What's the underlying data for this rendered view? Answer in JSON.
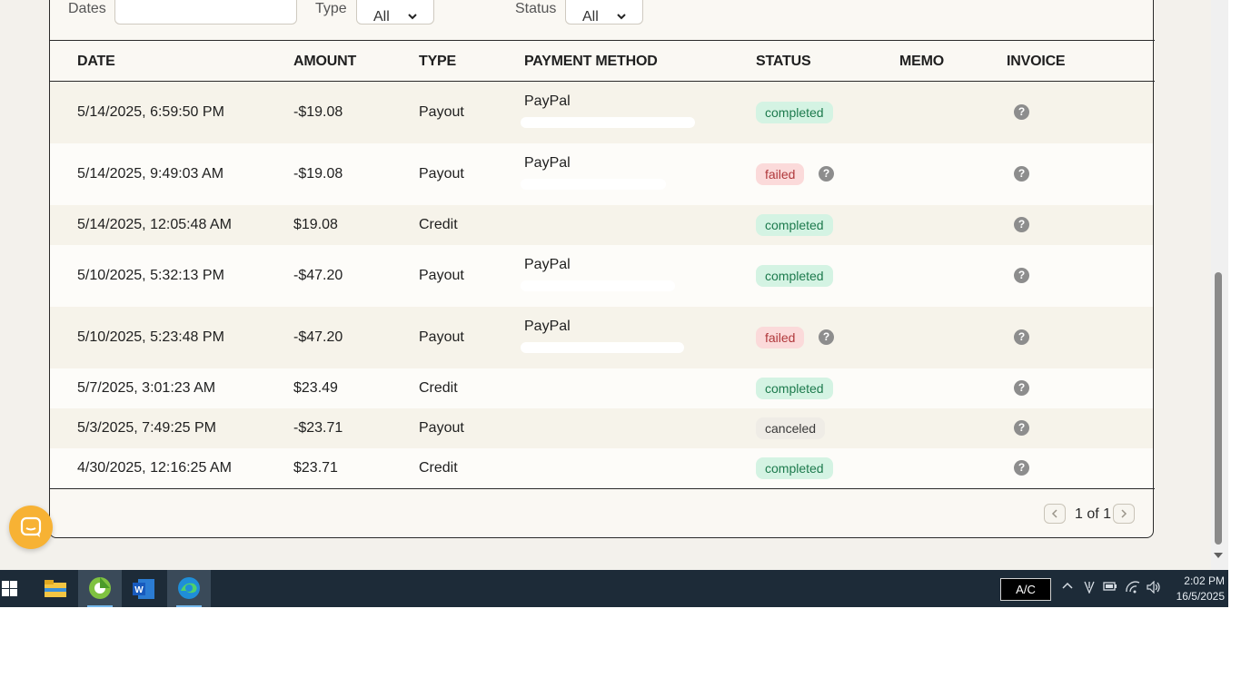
{
  "filters": {
    "dates_label": "Dates",
    "dates_value": "",
    "type_label": "Type",
    "type_value": "All",
    "status_label": "Status",
    "status_value": "All"
  },
  "table": {
    "headers": [
      "DATE",
      "AMOUNT",
      "TYPE",
      "PAYMENT METHOD",
      "STATUS",
      "MEMO",
      "INVOICE"
    ],
    "rows": [
      {
        "date": "5/14/2025, 6:59:50 PM",
        "amount": "-$19.08",
        "type": "Payout",
        "method": "PayPal",
        "status": "completed",
        "memo": ""
      },
      {
        "date": "5/14/2025, 9:49:03 AM",
        "amount": "-$19.08",
        "type": "Payout",
        "method": "PayPal",
        "status": "failed",
        "memo": ""
      },
      {
        "date": "5/14/2025, 12:05:48 AM",
        "amount": "$19.08",
        "type": "Credit",
        "method": "",
        "status": "completed",
        "memo": ""
      },
      {
        "date": "5/10/2025, 5:32:13 PM",
        "amount": "-$47.20",
        "type": "Payout",
        "method": "PayPal",
        "status": "completed",
        "memo": ""
      },
      {
        "date": "5/10/2025, 5:23:48 PM",
        "amount": "-$47.20",
        "type": "Payout",
        "method": "PayPal",
        "status": "failed",
        "memo": ""
      },
      {
        "date": "5/7/2025, 3:01:23 AM",
        "amount": "$23.49",
        "type": "Credit",
        "method": "",
        "status": "completed",
        "memo": ""
      },
      {
        "date": "5/3/2025, 7:49:25 PM",
        "amount": "-$23.71",
        "type": "Payout",
        "method": "",
        "status": "canceled",
        "memo": ""
      },
      {
        "date": "4/30/2025, 12:16:25 AM",
        "amount": "$23.71",
        "type": "Credit",
        "method": "",
        "status": "completed",
        "memo": ""
      }
    ]
  },
  "pagination": {
    "text": "1 of 1",
    "prev_icon": "chevron-left-icon",
    "next_icon": "chevron-right-icon"
  },
  "icons": {
    "help": "?",
    "chat": "chat-bubble-icon"
  },
  "colors": {
    "completed_bg": "#d4f3e3",
    "completed_text": "#1d7a4d",
    "failed_bg": "#fbdada",
    "failed_text": "#b0383b",
    "canceled_bg": "#efece6",
    "chat_accent": "#f7b234",
    "taskbar": "#1d2b38"
  },
  "taskbar": {
    "apps": [
      "file-explorer-icon",
      "green-app-icon",
      "word-icon",
      "edge-icon"
    ],
    "ac_label": "A/C",
    "time": "2:02 PM",
    "date": "16/5/2025"
  }
}
